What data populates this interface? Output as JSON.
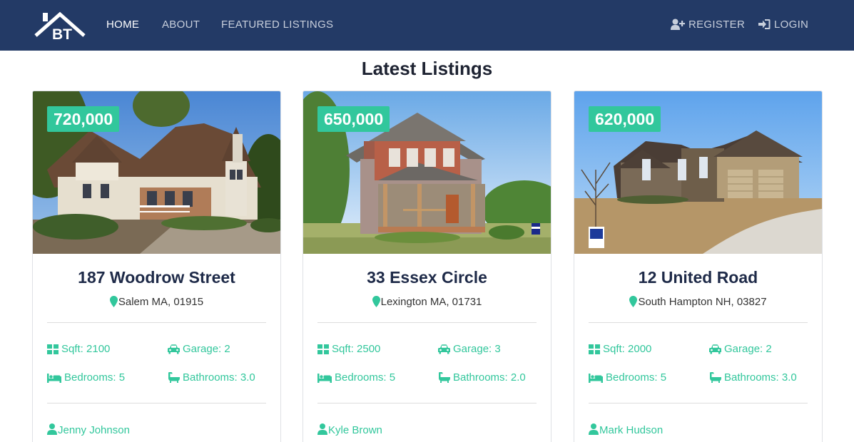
{
  "nav": {
    "logo_text": "BT",
    "home": "HOME",
    "about": "ABOUT",
    "featured": "FEATURED LISTINGS",
    "register": "REGISTER",
    "login": "LOGIN"
  },
  "page": {
    "title": "Latest Listings"
  },
  "colors": {
    "navbar": "#233a66",
    "accent": "#32c79c",
    "title": "#1e2a48"
  },
  "listings": [
    {
      "price": "720,000",
      "title": "187 Woodrow Street",
      "address": "Salem MA, 01915",
      "sqft": "Sqft: 2100",
      "garage": "Garage: 2",
      "bedrooms": "Bedrooms: 5",
      "bathrooms": "Bathrooms: 3.0",
      "agent": "Jenny Johnson"
    },
    {
      "price": "650,000",
      "title": "33 Essex Circle",
      "address": "Lexington MA, 01731",
      "sqft": "Sqft: 2500",
      "garage": "Garage: 3",
      "bedrooms": "Bedrooms: 5",
      "bathrooms": "Bathrooms: 2.0",
      "agent": "Kyle Brown"
    },
    {
      "price": "620,000",
      "title": "12 United Road",
      "address": "South Hampton NH, 03827",
      "sqft": "Sqft: 2000",
      "garage": "Garage: 2",
      "bedrooms": "Bedrooms: 5",
      "bathrooms": "Bathrooms: 3.0",
      "agent": "Mark Hudson"
    }
  ]
}
